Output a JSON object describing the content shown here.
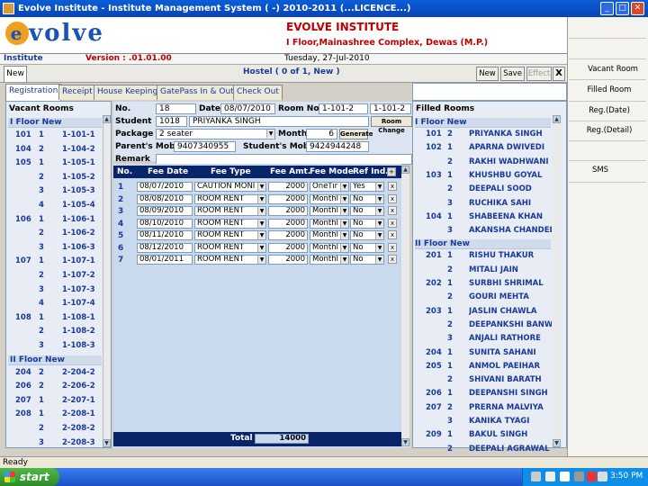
{
  "window": {
    "title": "Evolve Institute - Institute Management System ( -) 2010-2011 (...LICENCE...)"
  },
  "header": {
    "logo_letter": "e",
    "logo_rest": "volve",
    "institute_name": "EVOLVE INSTITUTE",
    "address": "I Floor,Mainashree Complex, Dewas (M.P.)"
  },
  "infobar": {
    "label": "Institute",
    "version": "Version : .01.01.00",
    "date": "Tuesday, 27-Jul-2010"
  },
  "topbar": {
    "tab": "New",
    "title": "Hostel   ( 0 of 1, New )",
    "new": "New",
    "save": "Save",
    "effect": "Effect",
    "close": "X"
  },
  "tabs": [
    "Registration",
    "Receipt",
    "House Keeping",
    "GatePass In & Out",
    "Check Out"
  ],
  "vacant": {
    "title": "Vacant Rooms",
    "floors": [
      {
        "name": "I Floor New",
        "rooms": [
          {
            "room": "101",
            "bed": "1",
            "code": "1-101-1"
          },
          {
            "room": "104",
            "bed": "2",
            "code": "1-104-2"
          },
          {
            "room": "105",
            "bed": "1",
            "code": "1-105-1"
          },
          {
            "room": "",
            "bed": "2",
            "code": "1-105-2"
          },
          {
            "room": "",
            "bed": "3",
            "code": "1-105-3"
          },
          {
            "room": "",
            "bed": "4",
            "code": "1-105-4"
          },
          {
            "room": "106",
            "bed": "1",
            "code": "1-106-1"
          },
          {
            "room": "",
            "bed": "2",
            "code": "1-106-2"
          },
          {
            "room": "",
            "bed": "3",
            "code": "1-106-3"
          },
          {
            "room": "107",
            "bed": "1",
            "code": "1-107-1"
          },
          {
            "room": "",
            "bed": "2",
            "code": "1-107-2"
          },
          {
            "room": "",
            "bed": "3",
            "code": "1-107-3"
          },
          {
            "room": "",
            "bed": "4",
            "code": "1-107-4"
          },
          {
            "room": "108",
            "bed": "1",
            "code": "1-108-1"
          },
          {
            "room": "",
            "bed": "2",
            "code": "1-108-2"
          },
          {
            "room": "",
            "bed": "3",
            "code": "1-108-3"
          }
        ]
      },
      {
        "name": "II Floor New",
        "rooms": [
          {
            "room": "204",
            "bed": "2",
            "code": "2-204-2"
          },
          {
            "room": "206",
            "bed": "2",
            "code": "2-206-2"
          },
          {
            "room": "207",
            "bed": "1",
            "code": "2-207-1"
          },
          {
            "room": "208",
            "bed": "1",
            "code": "2-208-1"
          },
          {
            "room": "",
            "bed": "2",
            "code": "2-208-2"
          },
          {
            "room": "",
            "bed": "3",
            "code": "2-208-3"
          }
        ]
      }
    ]
  },
  "form": {
    "no_label": "No.",
    "no": "18",
    "date_label": "Date",
    "date": "08/07/2010",
    "roomno_label": "Room No.",
    "room1": "1-101-2",
    "room2": "1-101-2",
    "student_label": "Student",
    "student_id": "1018",
    "student_name": "PRIYANKA SINGH",
    "room_change": "Room Change",
    "package_label": "Package",
    "package": "2 seater",
    "month_label": "Month",
    "month": "6",
    "generate": "Generate",
    "parent_label": "Parent's Mob.",
    "parent_mob": "9407340955",
    "student_mob_label": "Student's Mob.",
    "student_mob": "9424944248",
    "remark_label": "Remark",
    "remark": ""
  },
  "grid": {
    "headers": [
      "No.",
      "Fee Date",
      "Fee Type",
      "Fee Amt.",
      "Fee Mode",
      "Ref Ind."
    ],
    "add": "+",
    "rows": [
      {
        "no": "1",
        "date": "08/07/2010",
        "type": "CAUTION MONI",
        "amt": "2000",
        "mode": "OneTir",
        "ref": "Yes",
        "x": "x"
      },
      {
        "no": "2",
        "date": "08/08/2010",
        "type": "ROOM RENT",
        "amt": "2000",
        "mode": "Monthl",
        "ref": "No",
        "x": "x"
      },
      {
        "no": "3",
        "date": "08/09/2010",
        "type": "ROOM RENT",
        "amt": "2000",
        "mode": "Monthl",
        "ref": "No",
        "x": "x"
      },
      {
        "no": "4",
        "date": "08/10/2010",
        "type": "ROOM RENT",
        "amt": "2000",
        "mode": "Monthl",
        "ref": "No",
        "x": "x"
      },
      {
        "no": "5",
        "date": "08/11/2010",
        "type": "ROOM RENT",
        "amt": "2000",
        "mode": "Monthl",
        "ref": "No",
        "x": "x"
      },
      {
        "no": "6",
        "date": "08/12/2010",
        "type": "ROOM RENT",
        "amt": "2000",
        "mode": "Monthl",
        "ref": "No",
        "x": "x"
      },
      {
        "no": "7",
        "date": "08/01/2011",
        "type": "ROOM RENT",
        "amt": "2000",
        "mode": "Monthl",
        "ref": "No",
        "x": "x"
      }
    ],
    "total_label": "Total",
    "total": "14000"
  },
  "filled": {
    "title": "Filled Rooms",
    "floors": [
      {
        "name": "I Floor New",
        "rooms": [
          {
            "room": "101",
            "bed": "2",
            "name": "PRIYANKA SINGH"
          },
          {
            "room": "102",
            "bed": "1",
            "name": "APARNA DWIVEDI"
          },
          {
            "room": "",
            "bed": "2",
            "name": "RAKHI WADHWANI"
          },
          {
            "room": "103",
            "bed": "1",
            "name": "KHUSHBU GOYAL"
          },
          {
            "room": "",
            "bed": "2",
            "name": "DEEPALI SOOD"
          },
          {
            "room": "",
            "bed": "3",
            "name": "RUCHIKA SAHI"
          },
          {
            "room": "104",
            "bed": "1",
            "name": "SHABEENA KHAN"
          },
          {
            "room": "",
            "bed": "3",
            "name": "AKANSHA CHANDEL"
          }
        ]
      },
      {
        "name": "II Floor New",
        "rooms": [
          {
            "room": "201",
            "bed": "1",
            "name": "RISHU THAKUR"
          },
          {
            "room": "",
            "bed": "2",
            "name": "MITALI JAIN"
          },
          {
            "room": "202",
            "bed": "1",
            "name": "SURBHI SHRIMAL"
          },
          {
            "room": "",
            "bed": "2",
            "name": "GOURI MEHTA"
          },
          {
            "room": "203",
            "bed": "1",
            "name": "JASLIN CHAWLA"
          },
          {
            "room": "",
            "bed": "2",
            "name": "DEEPANKSHI BANW"
          },
          {
            "room": "",
            "bed": "3",
            "name": "ANJALI RATHORE"
          },
          {
            "room": "204",
            "bed": "1",
            "name": "SUNITA SAHANI"
          },
          {
            "room": "205",
            "bed": "1",
            "name": "ANMOL PAEIHAR"
          },
          {
            "room": "",
            "bed": "2",
            "name": "SHIVANI BARATH"
          },
          {
            "room": "206",
            "bed": "1",
            "name": "DEEPANSHI SINGH"
          },
          {
            "room": "207",
            "bed": "2",
            "name": "PRERNA MALVIYA"
          },
          {
            "room": "",
            "bed": "3",
            "name": "KANIKA TYAGI"
          },
          {
            "room": "209",
            "bed": "1",
            "name": "BAKUL SINGH"
          },
          {
            "room": "",
            "bed": "2",
            "name": "DEEPALI AGRAWAL"
          }
        ]
      }
    ]
  },
  "side": [
    "Vacant Room",
    "Filled Room",
    "Reg.(Date)",
    "Reg.(Detail)",
    "SMS"
  ],
  "status": "Ready",
  "taskbar": {
    "start": "start",
    "clock": "3:50 PM"
  }
}
